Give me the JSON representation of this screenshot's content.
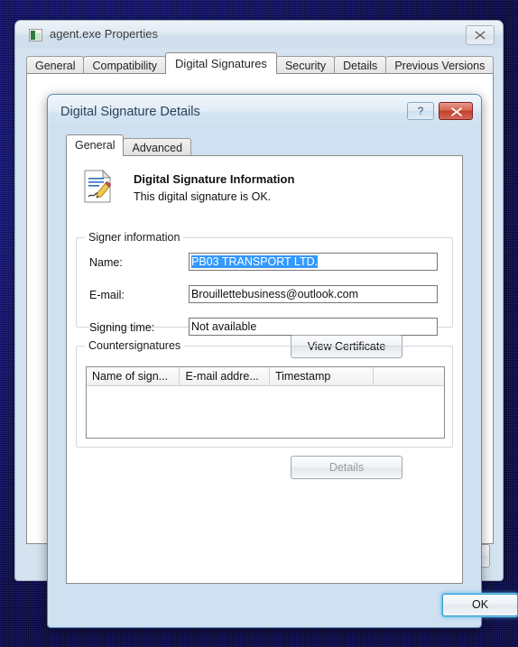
{
  "desktop": {
    "background_color": "#0a0a4e"
  },
  "outer_window": {
    "title": "agent.exe Properties",
    "icon": "application-icon",
    "close_label": "Close",
    "tabs": [
      {
        "label": "General",
        "active": false
      },
      {
        "label": "Compatibility",
        "active": false
      },
      {
        "label": "Digital Signatures",
        "active": true
      },
      {
        "label": "Security",
        "active": false
      },
      {
        "label": "Details",
        "active": false
      },
      {
        "label": "Previous Versions",
        "active": false
      }
    ]
  },
  "inner_dialog": {
    "title": "Digital Signature Details",
    "help_label": "?",
    "close_label": "Close",
    "tabs": [
      {
        "label": "General",
        "active": true
      },
      {
        "label": "Advanced",
        "active": false
      }
    ],
    "signature_info": {
      "heading": "Digital Signature Information",
      "status": "This digital signature is OK.",
      "icon": "signature-document-icon"
    },
    "signer_information": {
      "legend": "Signer information",
      "fields": [
        {
          "label": "Name:",
          "value": "PB03 TRANSPORT LTD.",
          "selected": true
        },
        {
          "label": "E-mail:",
          "value": "Brouillettebusiness@outlook.com",
          "selected": false
        },
        {
          "label": "Signing time:",
          "value": "Not available",
          "selected": false
        }
      ],
      "view_certificate_label": "View Certificate"
    },
    "countersignatures": {
      "legend": "Countersignatures",
      "columns": [
        "Name of sign...",
        "E-mail addre...",
        "Timestamp",
        ""
      ],
      "rows": [],
      "details_label": "Details",
      "details_disabled": true
    },
    "ok_label": "OK"
  },
  "colors": {
    "selection_blue": "#3399ff",
    "close_red": "#c2412c",
    "focus_glow": "#6ec4ea"
  }
}
